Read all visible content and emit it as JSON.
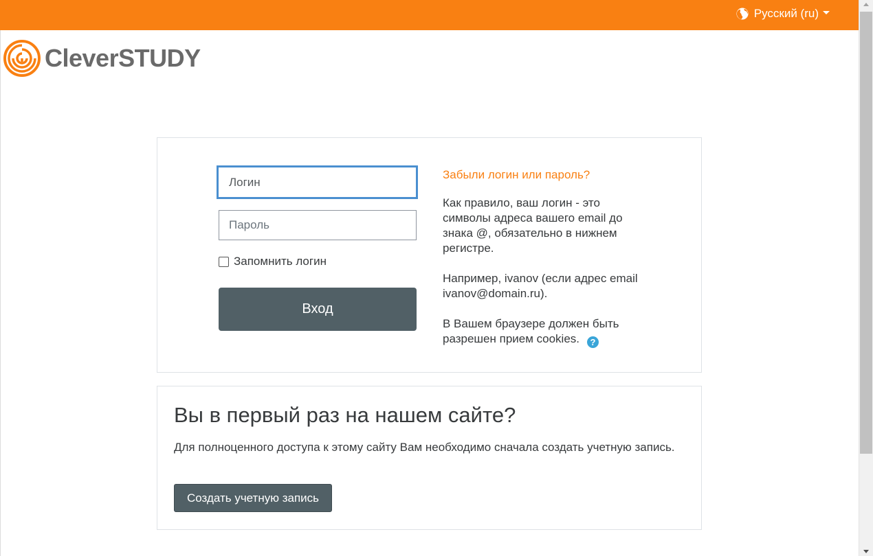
{
  "header": {
    "language_label": "Русский (ru)",
    "accent_color": "#f98012"
  },
  "brand": {
    "name": "CleverSTUDY"
  },
  "login": {
    "username_placeholder": "Логин",
    "password_placeholder": "Пароль",
    "remember_label": "Запомнить логин",
    "submit_label": "Вход",
    "forgot_link": "Забыли логин или пароль?",
    "info_1": "Как правило, ваш логин - это символы адреса вашего email до знака @, обязательно в нижнем регистре.",
    "info_2": "Например, ivanov (если адрес email ivanov@domain.ru).",
    "info_3": "В Вашем браузере должен быть разрешен прием cookies.",
    "help_glyph": "?"
  },
  "signup": {
    "title": "Вы в первый раз на нашем сайте?",
    "description": "Для полноценного доступа к этому сайту Вам необходимо сначала создать учетную запись.",
    "button_label": "Создать учетную запись"
  }
}
